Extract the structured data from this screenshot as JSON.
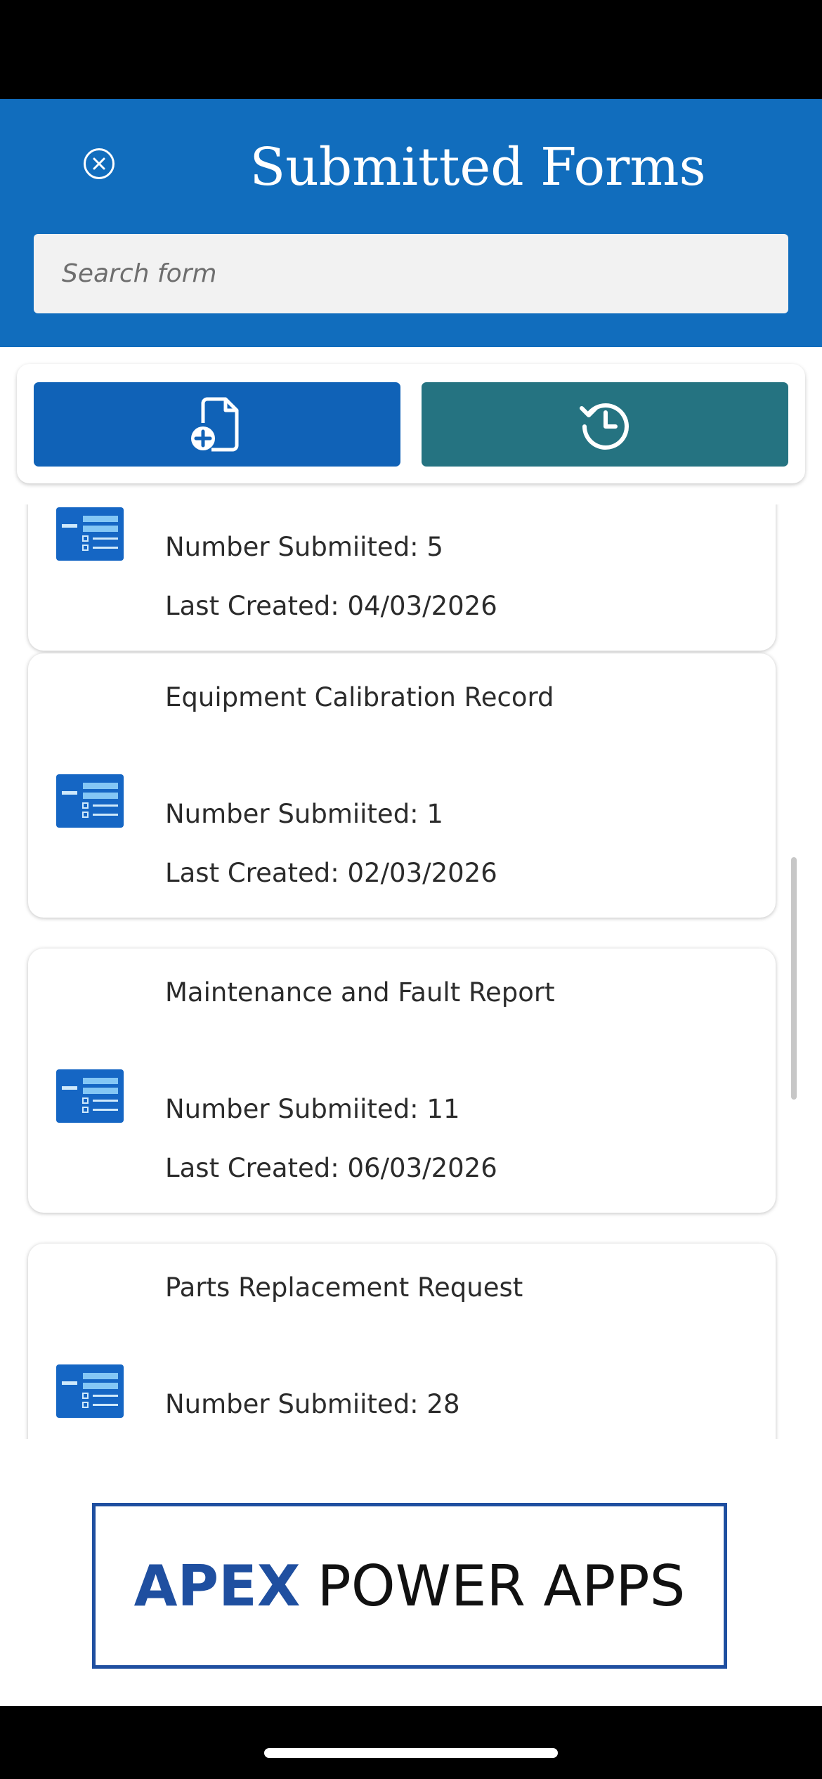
{
  "header": {
    "title": "Submitted Forms",
    "search_placeholder": "Search form",
    "background_color": "#116dbd"
  },
  "actions": {
    "new_form_icon": "new-document-icon",
    "history_icon": "history-icon",
    "new_color": "#1062b7",
    "history_color": "#257381"
  },
  "forms": [
    {
      "title": "",
      "count_text": "Number Submiited: 5",
      "date_text": "Last Created: 04/03/2026"
    },
    {
      "title": "Equipment Calibration Record",
      "count_text": "Number Submiited: 1",
      "date_text": "Last Created: 02/03/2026"
    },
    {
      "title": "Maintenance and Fault Report",
      "count_text": "Number Submiited: 11",
      "date_text": "Last Created: 06/03/2026"
    },
    {
      "title": "Parts Replacement Request",
      "count_text": "Number Submiited: 28",
      "date_text": ""
    }
  ],
  "footer": {
    "logo_bold": "APEX",
    "logo_rest": "POWER APPS",
    "logo_color": "#1f4fa0"
  }
}
